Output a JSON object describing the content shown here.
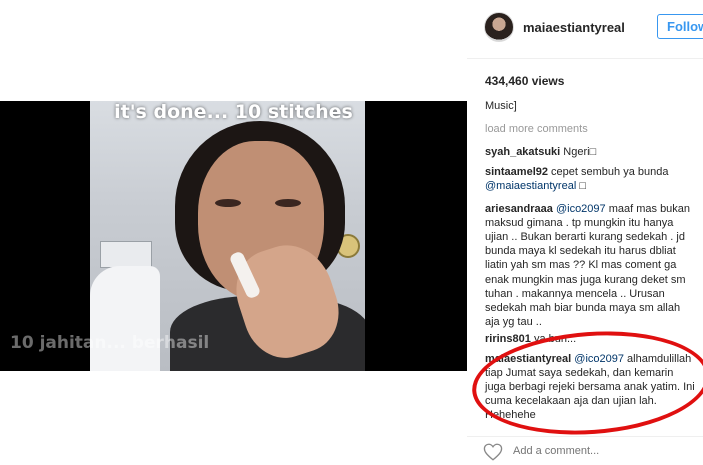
{
  "media": {
    "caption_top": "it's done... 10 stitches",
    "caption_bottom": "10 jahitan... berhasil"
  },
  "post": {
    "username": "maiaestiantyreal",
    "follow_label": "Follow",
    "views": "434,460 views"
  },
  "comments": {
    "truncated_prev": "Music]",
    "load_more": "load more comments",
    "items": [
      {
        "user": "syah_akatsuki",
        "mention": "",
        "text": "Ngeri□"
      },
      {
        "user": "sintaamel92",
        "mention": "",
        "text": "cepet sembuh ya bunda",
        "mention2": "@maiaestiantyreal",
        "text2": "□"
      },
      {
        "user": "ariesandraaa",
        "mention": "@ico2097",
        "text": "maaf mas bukan maksud gimana . tp mungkin itu hanya ujian .. Bukan berarti kurang sedekah . jd bunda maya kl sedekah itu harus dbliat liatin yah sm mas ?? Kl mas coment ga enak mungkin mas juga kurang deket sm tuhan . makannya mencela .. Urusan sedekah mah biar bunda maya sm allah aja yg tau .."
      },
      {
        "user": "ririns801",
        "mention": "",
        "text": "ya bun..."
      },
      {
        "user": "maiaestiantyreal",
        "mention": "@ico2097",
        "text": "alhamdulillah tiap Jumat saya sedekah, dan kemarin juga berbagi rejeki bersama anak yatim. Ini cuma kecelakaan aja dan ujian lah. Hehehehe"
      }
    ]
  },
  "footer": {
    "add_comment_placeholder": "Add a comment..."
  },
  "colors": {
    "accent": "#3897f0",
    "mention": "#003569",
    "highlight_ring": "#e01010"
  }
}
